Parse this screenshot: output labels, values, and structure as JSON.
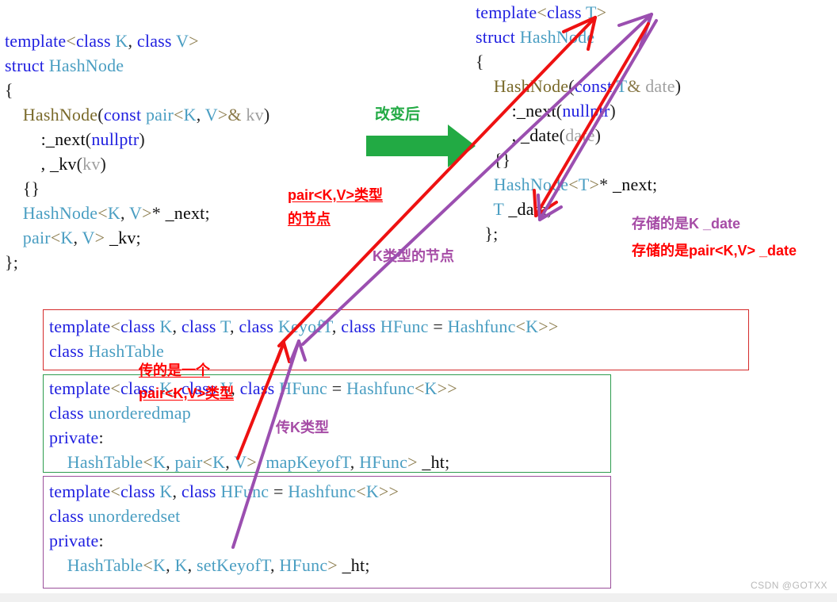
{
  "watermark": "CSDN @GOTXX",
  "left_code": {
    "name": "original-hashnode-code",
    "lines": [
      [
        {
          "t": "template",
          "c": "kw"
        },
        {
          "t": "<",
          "c": "op"
        },
        {
          "t": "class",
          "c": "kw"
        },
        {
          "t": " K",
          "c": "ty"
        },
        {
          "t": ", ",
          "c": "pun"
        },
        {
          "t": "class",
          "c": "kw"
        },
        {
          "t": " V",
          "c": "ty"
        },
        {
          "t": ">",
          "c": "op"
        }
      ],
      [
        {
          "t": "struct",
          "c": "kw"
        },
        {
          "t": " HashNode",
          "c": "ty"
        }
      ],
      [
        {
          "t": "{",
          "c": "pun"
        }
      ],
      [
        {
          "t": "    HashNode",
          "c": "fn"
        },
        {
          "t": "(",
          "c": "pun"
        },
        {
          "t": "const",
          "c": "kw"
        },
        {
          "t": " ",
          "c": "pun"
        },
        {
          "t": "pair",
          "c": "ty"
        },
        {
          "t": "<",
          "c": "op"
        },
        {
          "t": "K",
          "c": "ty"
        },
        {
          "t": ", ",
          "c": "pun"
        },
        {
          "t": "V",
          "c": "ty"
        },
        {
          "t": ">&",
          "c": "op"
        },
        {
          "t": " kv",
          "c": "gy"
        },
        {
          "t": ")",
          "c": "pun"
        }
      ],
      [
        {
          "t": "        :_next",
          "c": "pl"
        },
        {
          "t": "(",
          "c": "pun"
        },
        {
          "t": "nullptr",
          "c": "kw"
        },
        {
          "t": ")",
          "c": "pun"
        }
      ],
      [
        {
          "t": "        , _kv",
          "c": "pl"
        },
        {
          "t": "(",
          "c": "pun"
        },
        {
          "t": "kv",
          "c": "gy"
        },
        {
          "t": ")",
          "c": "pun"
        }
      ],
      [
        {
          "t": "    {}",
          "c": "pun"
        }
      ],
      [
        {
          "t": "    HashNode",
          "c": "ty"
        },
        {
          "t": "<",
          "c": "op"
        },
        {
          "t": "K",
          "c": "ty"
        },
        {
          "t": ", ",
          "c": "pun"
        },
        {
          "t": "V",
          "c": "ty"
        },
        {
          "t": ">",
          "c": "op"
        },
        {
          "t": "* ",
          "c": "pun"
        },
        {
          "t": "_next",
          "c": "pl"
        },
        {
          "t": ";",
          "c": "pun"
        }
      ],
      [
        {
          "t": "    pair",
          "c": "ty"
        },
        {
          "t": "<",
          "c": "op"
        },
        {
          "t": "K",
          "c": "ty"
        },
        {
          "t": ", ",
          "c": "pun"
        },
        {
          "t": "V",
          "c": "ty"
        },
        {
          "t": "> ",
          "c": "op"
        },
        {
          "t": "_kv",
          "c": "pl"
        },
        {
          "t": ";",
          "c": "pun"
        }
      ],
      [
        {
          "t": "};",
          "c": "pun"
        }
      ]
    ]
  },
  "right_code": {
    "name": "changed-hashnode-code",
    "lines": [
      [
        {
          "t": "template",
          "c": "kw"
        },
        {
          "t": "<",
          "c": "op"
        },
        {
          "t": "class",
          "c": "kw"
        },
        {
          "t": " T",
          "c": "ty"
        },
        {
          "t": ">",
          "c": "op"
        }
      ],
      [
        {
          "t": "struct",
          "c": "kw"
        },
        {
          "t": " HashNode",
          "c": "ty"
        }
      ],
      [
        {
          "t": "{",
          "c": "pun"
        }
      ],
      [
        {
          "t": "    HashNode",
          "c": "fn"
        },
        {
          "t": "(",
          "c": "pun"
        },
        {
          "t": "const",
          "c": "kw"
        },
        {
          "t": " ",
          "c": "pun"
        },
        {
          "t": "T",
          "c": "ty"
        },
        {
          "t": "&",
          "c": "op"
        },
        {
          "t": " date",
          "c": "gy"
        },
        {
          "t": ")",
          "c": "pun"
        }
      ],
      [
        {
          "t": "        :_next",
          "c": "pl"
        },
        {
          "t": "(",
          "c": "pun"
        },
        {
          "t": "nullptr",
          "c": "kw"
        },
        {
          "t": ")",
          "c": "pun"
        }
      ],
      [
        {
          "t": "        , _date",
          "c": "pl"
        },
        {
          "t": "(",
          "c": "pun"
        },
        {
          "t": "date",
          "c": "gy"
        },
        {
          "t": ")",
          "c": "pun"
        }
      ],
      [
        {
          "t": "    {}",
          "c": "pun"
        }
      ],
      [
        {
          "t": "    HashNode",
          "c": "ty"
        },
        {
          "t": "<",
          "c": "op"
        },
        {
          "t": "T",
          "c": "ty"
        },
        {
          "t": ">",
          "c": "op"
        },
        {
          "t": "* ",
          "c": "pun"
        },
        {
          "t": "_next",
          "c": "pl"
        },
        {
          "t": ";",
          "c": "pun"
        }
      ],
      [
        {
          "t": "    T",
          "c": "ty"
        },
        {
          "t": " _date",
          "c": "pl"
        },
        {
          "t": ";",
          "c": "pun"
        }
      ],
      [
        {
          "t": "  };",
          "c": "pun"
        }
      ]
    ]
  },
  "box_hashtable": {
    "name": "hashtable-declaration",
    "border_color": "#d42b2b",
    "lines": [
      [
        {
          "t": "template",
          "c": "kw"
        },
        {
          "t": "<",
          "c": "op"
        },
        {
          "t": "class",
          "c": "kw"
        },
        {
          "t": " K",
          "c": "ty"
        },
        {
          "t": ", ",
          "c": "pun"
        },
        {
          "t": "class",
          "c": "kw"
        },
        {
          "t": " T",
          "c": "ty"
        },
        {
          "t": ", ",
          "c": "pun"
        },
        {
          "t": "class",
          "c": "kw"
        },
        {
          "t": " KeyofT",
          "c": "ty"
        },
        {
          "t": ", ",
          "c": "pun"
        },
        {
          "t": "class",
          "c": "kw"
        },
        {
          "t": " HFunc",
          "c": "ty"
        },
        {
          "t": " = ",
          "c": "pun"
        },
        {
          "t": "Hashfunc",
          "c": "ty"
        },
        {
          "t": "<",
          "c": "op"
        },
        {
          "t": "K",
          "c": "ty"
        },
        {
          "t": ">>",
          "c": "op"
        }
      ],
      [
        {
          "t": "class",
          "c": "kw"
        },
        {
          "t": " HashTable",
          "c": "ty"
        }
      ]
    ]
  },
  "box_unorderedmap": {
    "name": "unorderedmap-declaration",
    "border_color": "#2e9c4e",
    "lines": [
      [
        {
          "t": "template",
          "c": "kw"
        },
        {
          "t": "<",
          "c": "op"
        },
        {
          "t": "class",
          "c": "kw"
        },
        {
          "t": " K",
          "c": "ty"
        },
        {
          "t": ", ",
          "c": "pun"
        },
        {
          "t": "class",
          "c": "kw"
        },
        {
          "t": " V",
          "c": "ty"
        },
        {
          "t": ", ",
          "c": "pun"
        },
        {
          "t": "class",
          "c": "kw"
        },
        {
          "t": " HFunc",
          "c": "ty"
        },
        {
          "t": " = ",
          "c": "pun"
        },
        {
          "t": "Hashfunc",
          "c": "ty"
        },
        {
          "t": "<",
          "c": "op"
        },
        {
          "t": "K",
          "c": "ty"
        },
        {
          "t": ">>",
          "c": "op"
        }
      ],
      [
        {
          "t": "class",
          "c": "kw"
        },
        {
          "t": " unorderedmap",
          "c": "ty"
        }
      ],
      [
        {
          "t": "private",
          "c": "kw"
        },
        {
          "t": ":",
          "c": "pun"
        }
      ],
      [
        {
          "t": "    HashTable",
          "c": "ty"
        },
        {
          "t": "<",
          "c": "op"
        },
        {
          "t": "K",
          "c": "ty"
        },
        {
          "t": ", ",
          "c": "pun"
        },
        {
          "t": "pair",
          "c": "ty"
        },
        {
          "t": "<",
          "c": "op"
        },
        {
          "t": "K",
          "c": "ty"
        },
        {
          "t": ", ",
          "c": "pun"
        },
        {
          "t": "V",
          "c": "ty"
        },
        {
          "t": ">",
          "c": "op"
        },
        {
          "t": ", ",
          "c": "pun"
        },
        {
          "t": "mapKeyofT",
          "c": "ty"
        },
        {
          "t": ", ",
          "c": "pun"
        },
        {
          "t": "HFunc",
          "c": "ty"
        },
        {
          "t": "> ",
          "c": "op"
        },
        {
          "t": "_ht",
          "c": "pl"
        },
        {
          "t": ";",
          "c": "pun"
        }
      ]
    ]
  },
  "box_unorderedset": {
    "name": "unorderedset-declaration",
    "border_color": "#9b4f9b",
    "lines": [
      [
        {
          "t": "template",
          "c": "kw"
        },
        {
          "t": "<",
          "c": "op"
        },
        {
          "t": "class",
          "c": "kw"
        },
        {
          "t": " K",
          "c": "ty"
        },
        {
          "t": ", ",
          "c": "pun"
        },
        {
          "t": "class",
          "c": "kw"
        },
        {
          "t": " HFunc",
          "c": "ty"
        },
        {
          "t": " = ",
          "c": "pun"
        },
        {
          "t": "Hashfunc",
          "c": "ty"
        },
        {
          "t": "<",
          "c": "op"
        },
        {
          "t": "K",
          "c": "ty"
        },
        {
          "t": ">>",
          "c": "op"
        }
      ],
      [
        {
          "t": "class",
          "c": "kw"
        },
        {
          "t": " unorderedset",
          "c": "ty"
        }
      ],
      [
        {
          "t": "private",
          "c": "kw"
        },
        {
          "t": ":",
          "c": "pun"
        }
      ],
      [
        {
          "t": "    HashTable",
          "c": "ty"
        },
        {
          "t": "<",
          "c": "op"
        },
        {
          "t": "K",
          "c": "ty"
        },
        {
          "t": ", ",
          "c": "pun"
        },
        {
          "t": "K",
          "c": "ty"
        },
        {
          "t": ", ",
          "c": "pun"
        },
        {
          "t": "setKeyofT",
          "c": "ty"
        },
        {
          "t": ", ",
          "c": "pun"
        },
        {
          "t": "HFunc",
          "c": "ty"
        },
        {
          "t": "> ",
          "c": "op"
        },
        {
          "t": "_ht",
          "c": "pl"
        },
        {
          "t": ";",
          "c": "pun"
        }
      ]
    ]
  },
  "annotations": {
    "after_change": "改变后",
    "pair_node_line1": "pair<K,V>类型",
    "pair_node_line2": "的节点",
    "k_node": "K类型的节点",
    "stores_k": "存储的是K _date",
    "stores_pair": "存储的是pair<K,V> _date",
    "pass_one_line1": "传的是一个",
    "pass_one_line2": "pair<K,V>类型",
    "pass_k": "传K类型"
  },
  "colors": {
    "red": "#ff0000",
    "purple": "#a64ca6",
    "green_arrow": "#22aa44",
    "green_text": "#22aa44",
    "keyword_blue": "#2020e0",
    "type_teal": "#4a9ec2",
    "func_olive": "#7a6a2a"
  }
}
